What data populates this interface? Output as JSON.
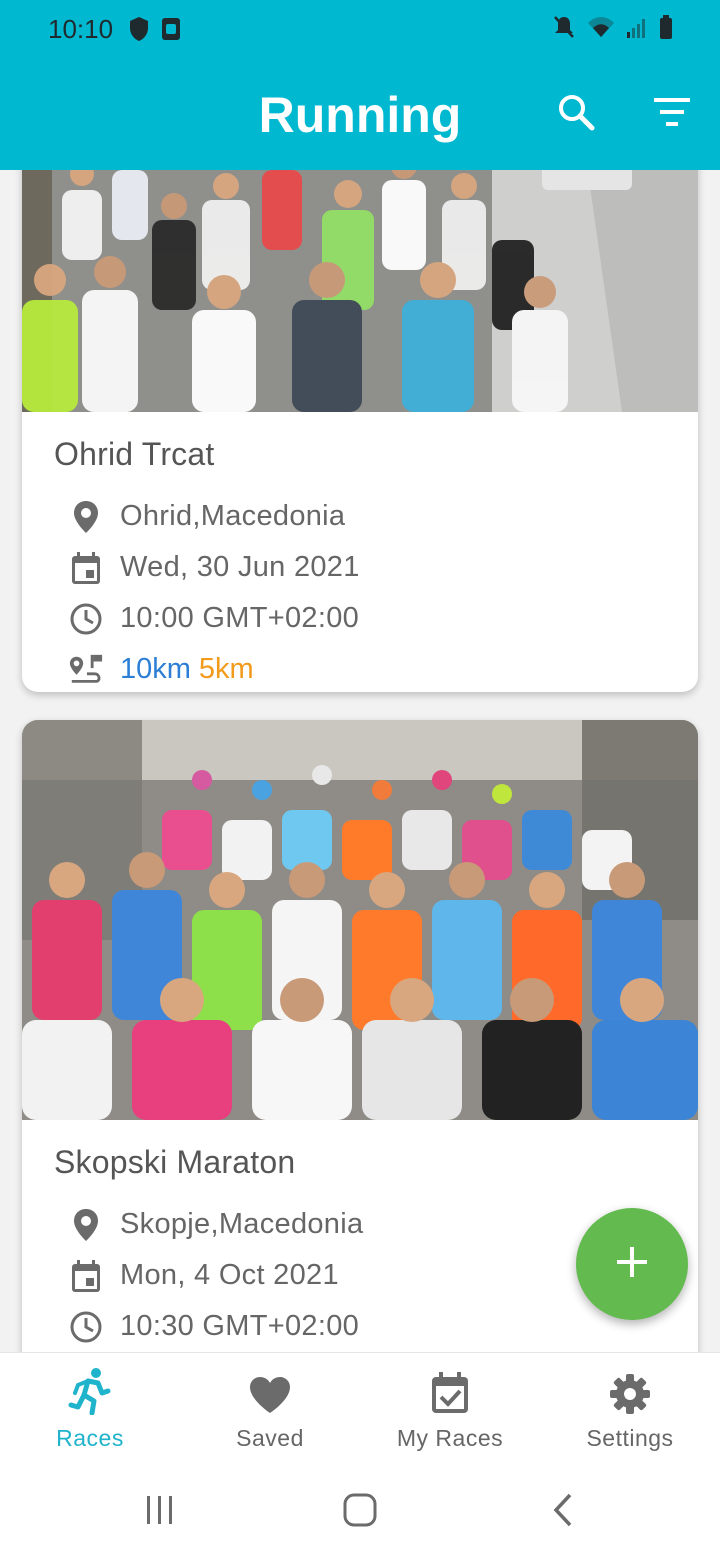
{
  "status_bar": {
    "time": "10:10"
  },
  "app_bar": {
    "title": "Running"
  },
  "races": [
    {
      "name": "Ohrid Trcat",
      "location": "Ohrid,Macedonia",
      "date": "Wed, 30 Jun 2021",
      "time": "10:00 GMT+02:00",
      "distances": [
        "10km",
        "5km"
      ]
    },
    {
      "name": "Skopski Maraton",
      "location": "Skopje,Macedonia",
      "date": "Mon, 4 Oct 2021",
      "time": "10:30 GMT+02:00"
    }
  ],
  "bottom_nav": {
    "items": [
      {
        "label": "Races",
        "icon": "runner-icon",
        "active": true
      },
      {
        "label": "Saved",
        "icon": "heart-icon"
      },
      {
        "label": "My Races",
        "icon": "calendar-check-icon"
      },
      {
        "label": "Settings",
        "icon": "gear-icon"
      }
    ]
  },
  "colors": {
    "app_bar": "#00b8cf",
    "accent": "#1fb3cc",
    "fab": "#63bb4f",
    "distance_primary": "#2d7fd6",
    "distance_secondary": "#f29a1a"
  }
}
